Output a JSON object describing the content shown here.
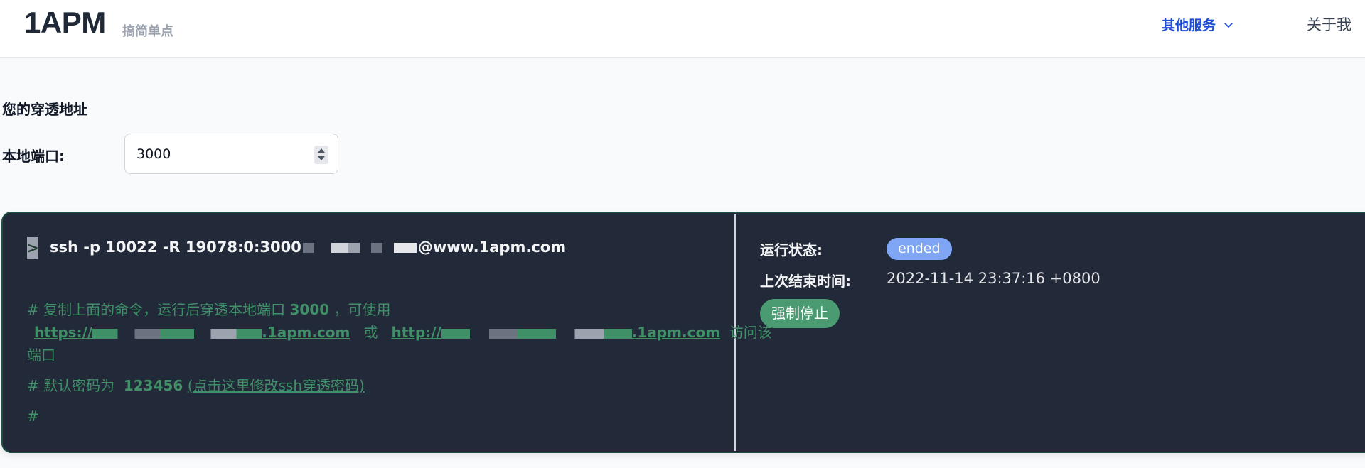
{
  "header": {
    "brand": "1APM",
    "tagline": "搞简单点",
    "nav_services": "其他服务",
    "nav_about": "关于我"
  },
  "form": {
    "section_title": "您的穿透地址",
    "port_label": "本地端口:",
    "port_value": "3000"
  },
  "terminal": {
    "prompt": ">",
    "command_prefix": "ssh -p 10022 -R 19078:0:3000",
    "command_suffix": "@www.1apm.com",
    "comment1_text": "# 复制上面的命令，运行后穿透本地端口",
    "comment1_port": "3000",
    "comment1_tail": "，可使用",
    "link_https_prefix": "https://",
    "link_https_suffix": ".1apm.com",
    "or_text": "或",
    "link_http_prefix": "http://",
    "link_http_suffix": ".1apm.com",
    "comment2_tail": "访问该",
    "comment2_wrap": "端口",
    "password_text": "# 默认密码为",
    "password_value": "123456",
    "password_link": "(点击这里修改ssh穿透密码)",
    "last_prompt": "#"
  },
  "status": {
    "run_label": "运行状态:",
    "run_value": "ended",
    "last_end_label": "上次结束时间:",
    "last_end_value": "2022-11-14 23:37:16 +0800",
    "stop_button": "强制停止"
  },
  "colors": {
    "panel_bg": "#222938",
    "comment_green": "#3f8f67",
    "badge_blue": "#7fa6f5",
    "stop_green": "#4b9b72",
    "nav_blue": "#1d4ed8"
  }
}
